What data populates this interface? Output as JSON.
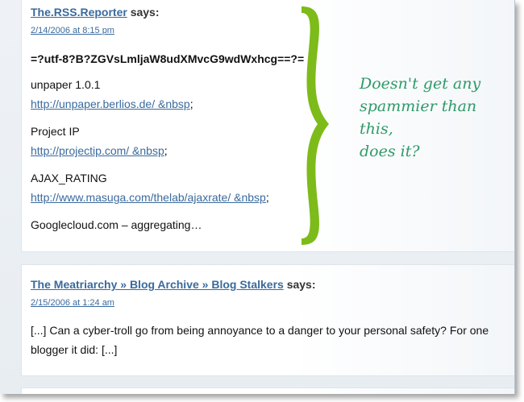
{
  "comments": [
    {
      "author": "The.RSS.Reporter",
      "says": " says:",
      "date": "2/14/2006 at 8:15 pm",
      "subject": "=?utf-8?B?ZGVsLmljaW8udXMvcG9wdWxhcg==?=",
      "items": [
        {
          "label": "unpaper 1.0.1",
          "link": "http://unpaper.berlios.de/ &nbsp",
          "suffix": ";"
        },
        {
          "label": "Project IP",
          "link": "http://projectip.com/ &nbsp",
          "suffix": ";"
        },
        {
          "label": "AJAX_RATING",
          "link": "http://www.masuga.com/thelab/ajaxrate/ &nbsp",
          "suffix": ";"
        }
      ],
      "last_line": "Googlecloud.com – aggregating…"
    },
    {
      "author": "The Meatriarchy » Blog Archive » Blog Stalkers",
      "says": " says:",
      "date": "2/15/2006 at 1:24 am",
      "body": "[...] Can a cyber-troll go from being annoyance to a danger to your personal safety? For one blogger it did: [...]"
    }
  ],
  "annotation": {
    "line1": "Doesn't get any",
    "line2": "spammier than this,",
    "line3": "does it?",
    "color": "#2e9a6a",
    "brace_color": "#7dbb1a"
  }
}
